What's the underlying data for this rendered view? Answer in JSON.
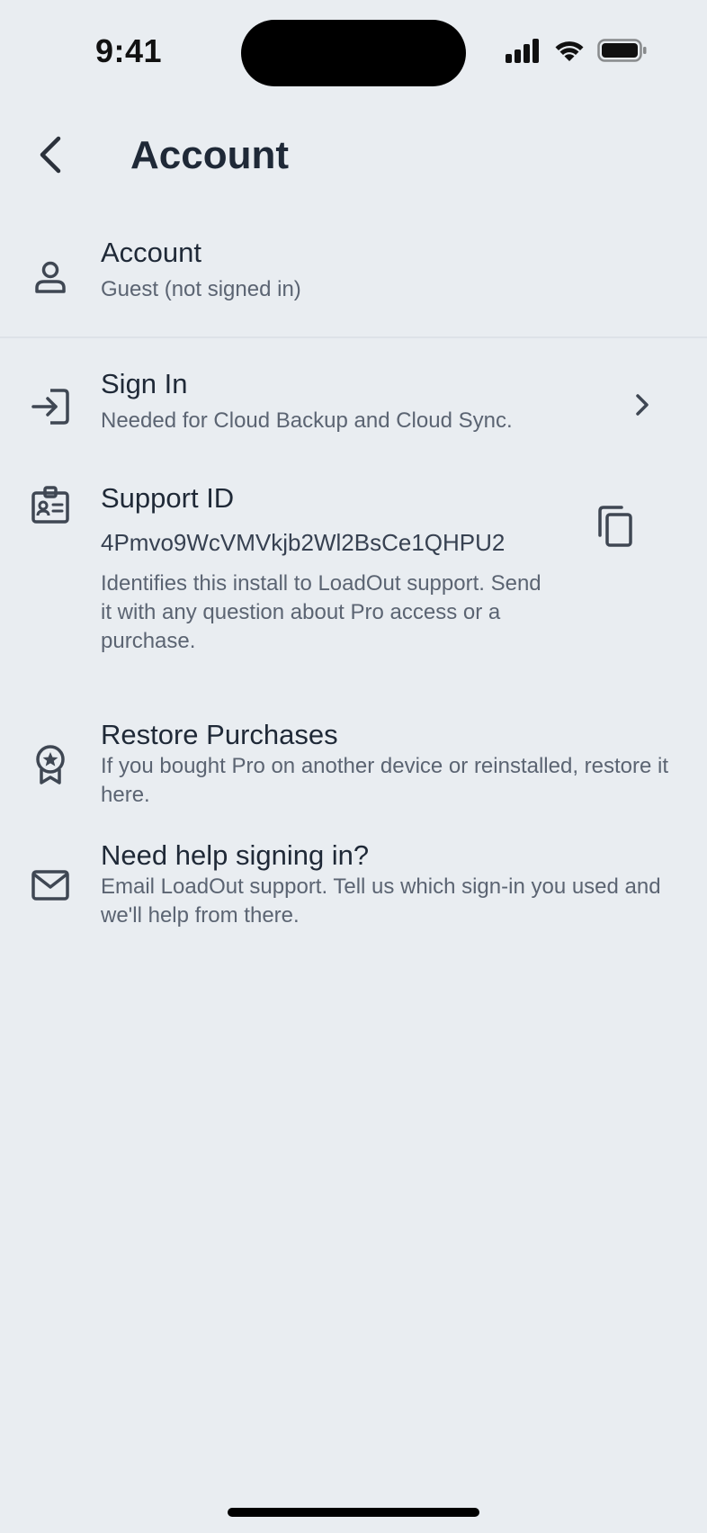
{
  "status_bar": {
    "time": "9:41"
  },
  "header": {
    "title": "Account",
    "back_icon": "chevron-left-icon"
  },
  "rows": {
    "account": {
      "icon": "person-icon",
      "title": "Account",
      "subtitle": "Guest (not signed in)"
    },
    "sign_in": {
      "icon": "sign-in-icon",
      "title": "Sign In",
      "subtitle": "Needed for Cloud Backup and Cloud Sync.",
      "trailing_icon": "chevron-right-icon"
    },
    "support_id": {
      "icon": "id-badge-icon",
      "title": "Support ID",
      "value": "4Pmvo9WcVMVkjb2Wl2BsCe1QHPU2",
      "description": "Identifies this install to LoadOut support. Send it with any question about Pro access or a purchase.",
      "trailing_icon": "copy-icon"
    },
    "restore": {
      "icon": "award-icon",
      "title": "Restore Purchases",
      "subtitle": "If you bought Pro on another device or reinstalled, restore it here."
    },
    "help": {
      "icon": "mail-icon",
      "title": "Need help signing in?",
      "subtitle": "Email LoadOut support. Tell us which sign-in you used and we'll help from there."
    }
  },
  "colors": {
    "background": "#e9edf1",
    "text_primary": "#1f2937",
    "text_secondary": "#5b6472",
    "icon": "#3f4753"
  }
}
